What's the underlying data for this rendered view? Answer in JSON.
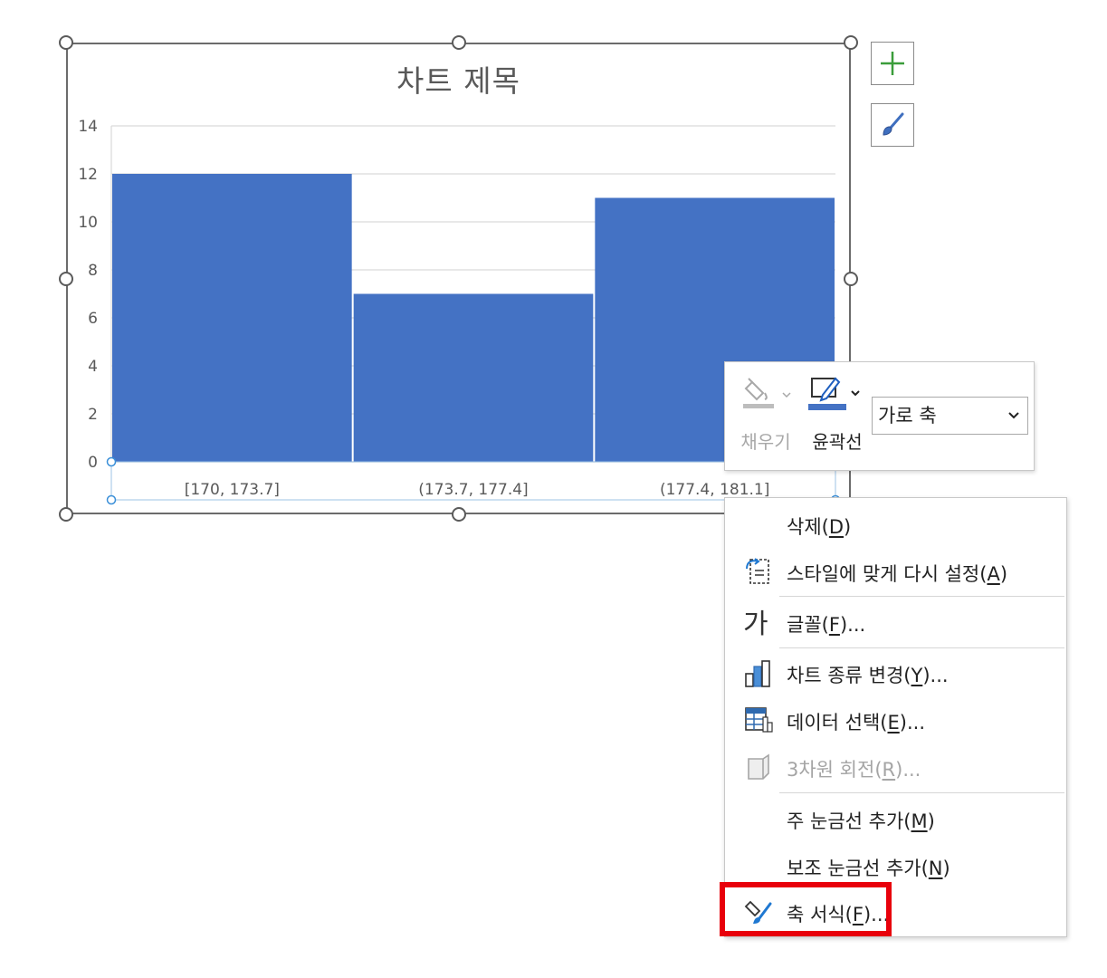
{
  "chart": {
    "title": "차트 제목"
  },
  "chart_data": {
    "type": "bar",
    "categories": [
      "[170, 173.7]",
      "(173.7, 177.4]",
      "(177.4, 181.1]"
    ],
    "values": [
      12,
      7,
      11
    ],
    "title": "차트 제목",
    "ylim": [
      0,
      14
    ],
    "yticks": [
      0,
      2,
      4,
      6,
      8,
      10,
      12,
      14
    ],
    "grid": true,
    "bar_color": "#4472c4"
  },
  "side_buttons": {
    "add": "plus-icon",
    "style": "brush-icon"
  },
  "mini_toolbar": {
    "fill_label": "채우기",
    "outline_label": "윤곽선",
    "element_selected": "가로 축",
    "outline_color": "#4472c4"
  },
  "context_menu": {
    "items": [
      {
        "label": "삭제",
        "key": "D",
        "suffix": ""
      },
      {
        "label": "스타일에 맞게 다시 설정",
        "key": "A",
        "suffix": ""
      },
      {
        "label": "글꼴",
        "key": "F",
        "suffix": "...",
        "icon_text": "가"
      },
      {
        "label": "차트 종류 변경",
        "key": "Y",
        "suffix": "..."
      },
      {
        "label": "데이터 선택",
        "key": "E",
        "suffix": "..."
      },
      {
        "label": "3차원 회전",
        "key": "R",
        "suffix": "..."
      },
      {
        "label": "주 눈금선 추가",
        "key": "M",
        "suffix": ""
      },
      {
        "label": "보조 눈금선 추가",
        "key": "N",
        "suffix": ""
      },
      {
        "label": "축 서식",
        "key": "F",
        "suffix": "..."
      }
    ]
  },
  "colors": {
    "highlight": "#e8000b",
    "accent_green": "#3a9d3a"
  }
}
